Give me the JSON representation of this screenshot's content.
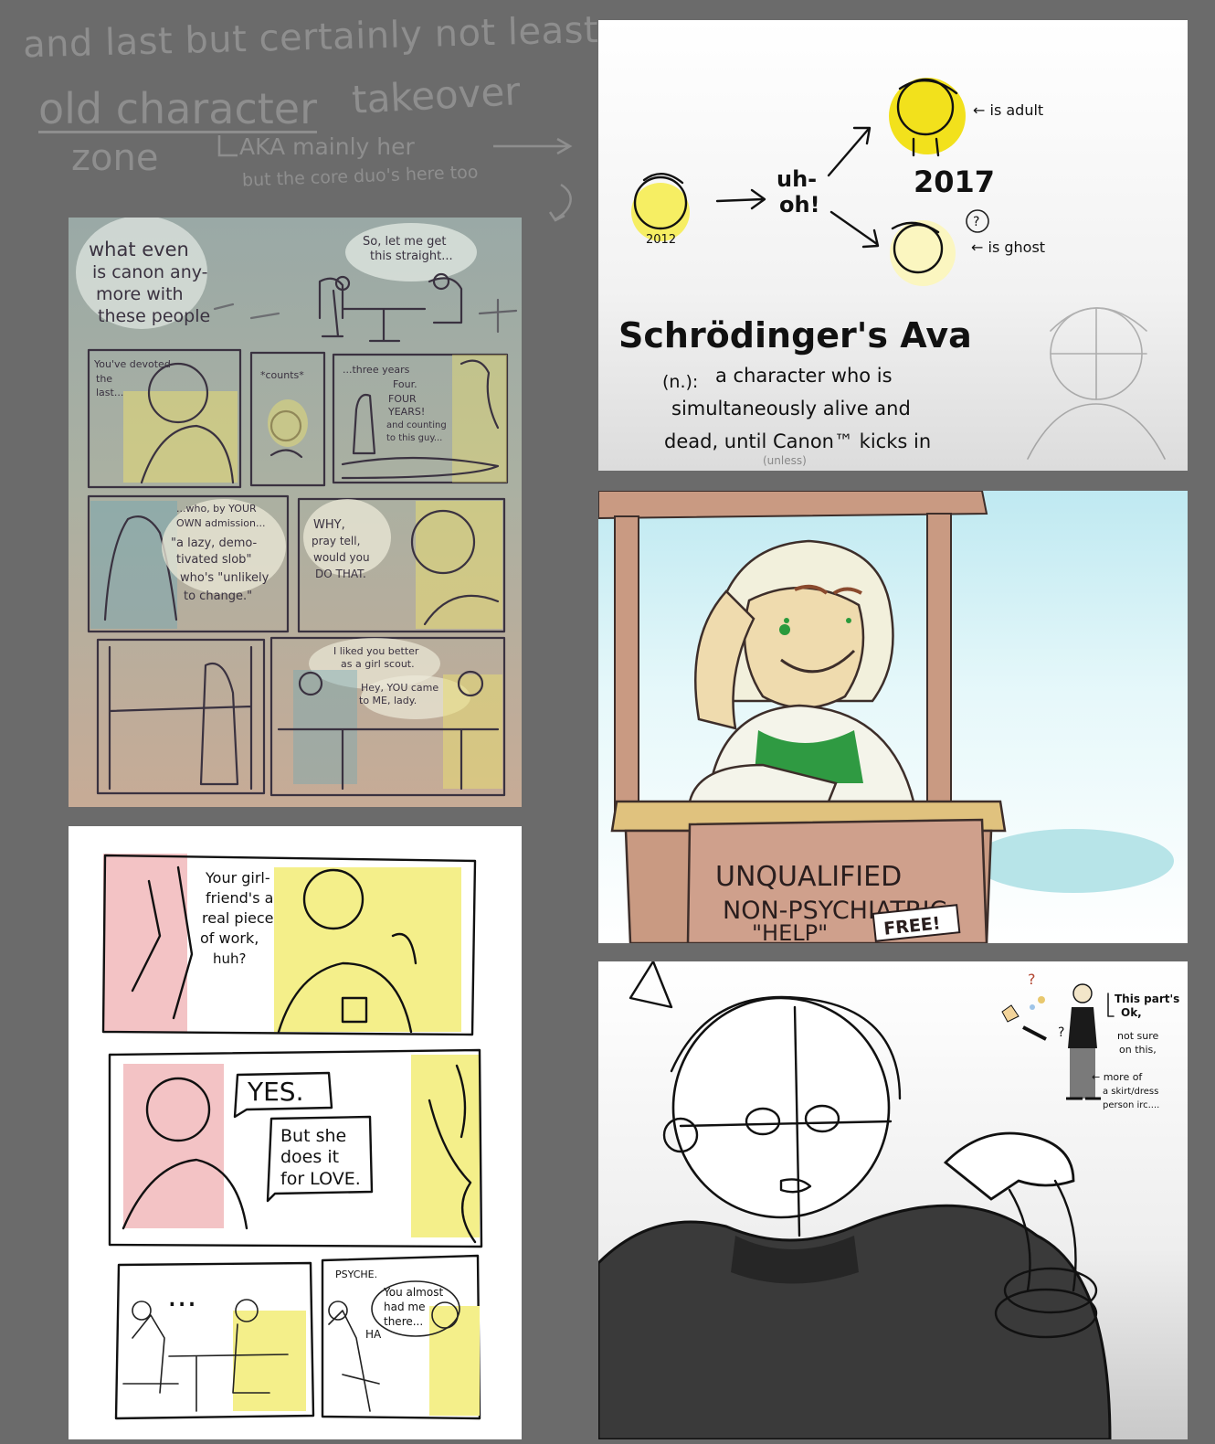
{
  "header": {
    "line1": "and last but certainly not least,",
    "line2_a": "old character",
    "line2_b": "takeover",
    "line3": "zone",
    "note1": "AKA mainly her",
    "note2": "but the core duo's here too"
  },
  "comic_page_1": {
    "caption": [
      "what even",
      "is canon any-",
      "more with",
      "these people"
    ],
    "bubble_top": [
      "So, let me get",
      "this straight..."
    ],
    "p2": [
      "You've devoted",
      "the",
      "last..."
    ],
    "p3": "*counts*",
    "p4": [
      "...three years",
      "Four.",
      "FOUR",
      "YEARS!",
      "and counting",
      "to this guy..."
    ],
    "p5": [
      "...who, by YOUR",
      "OWN admission...",
      "\"a lazy, demo-",
      "tivated slob\"",
      "who's \"unlikely",
      "to change.\""
    ],
    "p6": [
      "WHY,",
      "pray tell,",
      "would you",
      "DO THAT."
    ],
    "p8": [
      "I liked you better",
      "as a girl scout.",
      "Hey, YOU came",
      "to ME, lady."
    ]
  },
  "comic_page_2": {
    "p1": [
      "Your girl-",
      "friend's a",
      "real piece",
      "of work,",
      "huh?"
    ],
    "p2a": "YES.",
    "p2b": [
      "But she",
      "does it",
      "for LOVE."
    ],
    "p3": "...",
    "p4a": "PSYCHE.",
    "p4b": [
      "You almost",
      "had me",
      "there..."
    ],
    "p4c": "HA"
  },
  "schrodinger": {
    "year_old": "2012",
    "uh_oh": [
      "uh-",
      "oh!"
    ],
    "year_new": "2017",
    "adult": "← is adult",
    "ghost": "← is ghost",
    "question": "?",
    "title": "Schrödinger's Ava",
    "def_label": "(n.):",
    "def_lines": [
      "a character who is",
      "simultaneously alive and",
      "dead, until Canon™ kicks in"
    ],
    "unless": "(unless)"
  },
  "booth": {
    "sign1": "UNQUALIFIED",
    "sign2": "NON-PSYCHIATRIC",
    "sign3": "\"HELP\"",
    "free": "FREE!"
  },
  "sketch": {
    "notes": [
      "This part's",
      "Ok,",
      "not sure",
      "on this,",
      "← more of",
      "a skirt/dress",
      "person irc...."
    ]
  },
  "colors": {
    "background": "#6b6b6b",
    "header_text": "#8e8e8e",
    "highlight_yellow": "#f2e11c",
    "page1_bg_top": "#9aa7a3",
    "page1_bg_bottom": "#c7aa96",
    "booth_sky": "#d9f2f5",
    "booth_wood": "#c99a82"
  }
}
